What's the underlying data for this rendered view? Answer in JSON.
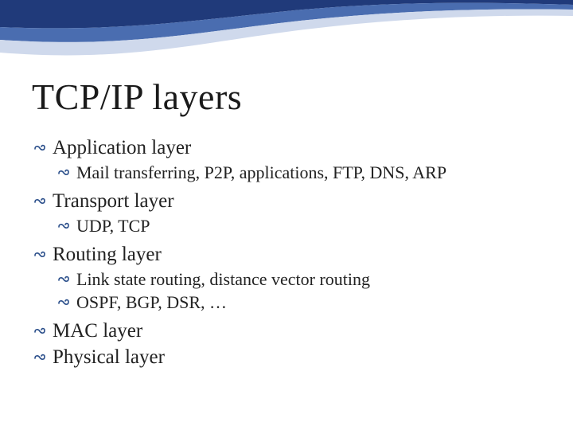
{
  "slide": {
    "title": "TCP/IP layers",
    "items": [
      {
        "label": "Application layer",
        "sub": [
          "Mail transferring, P2P, applications, FTP, DNS, ARP"
        ]
      },
      {
        "label": "Transport layer",
        "sub": [
          "UDP, TCP"
        ]
      },
      {
        "label": "Routing layer",
        "sub": [
          "Link state routing, distance vector routing",
          "OSPF, BGP, DSR, …"
        ]
      },
      {
        "label": "MAC layer",
        "sub": []
      },
      {
        "label": "Physical layer",
        "sub": []
      }
    ]
  }
}
